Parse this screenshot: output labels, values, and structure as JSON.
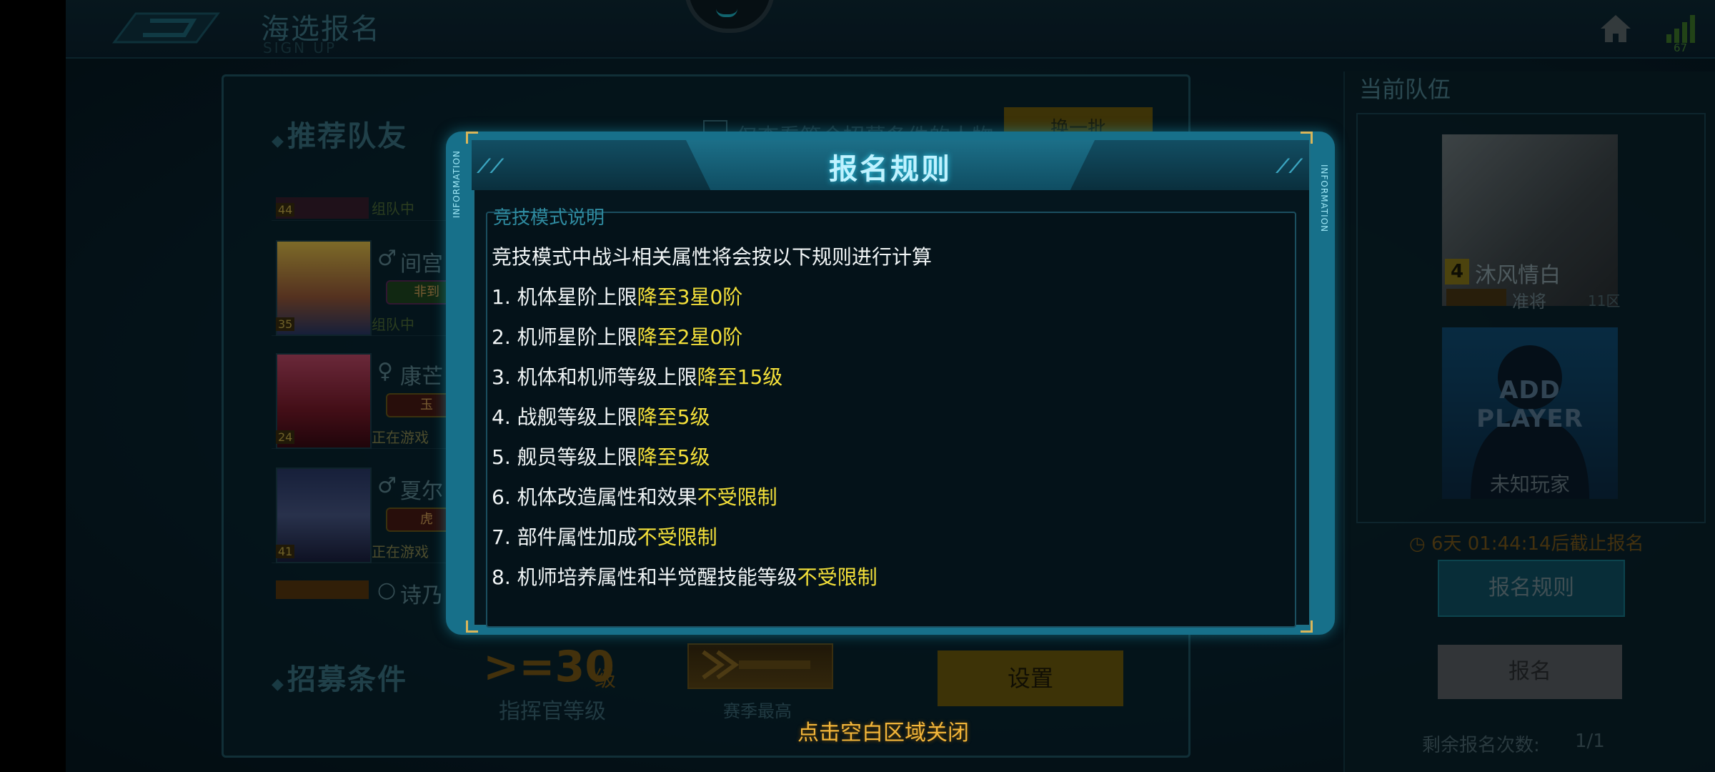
{
  "header": {
    "title": "海选报名",
    "subtitle": "SIGN UP",
    "signal_value": "67"
  },
  "recommend": {
    "title": "推荐队友",
    "filter_label": "仅查看符合招募条件的人物",
    "swap_label": "换一批",
    "mates": [
      {
        "name": "",
        "status": "组队中",
        "level": "44"
      },
      {
        "name": "间宫",
        "status": "组队中",
        "level": "35",
        "tag": "非到"
      },
      {
        "name": "康芒",
        "status": "正在游戏",
        "level": "24",
        "tag": "玉"
      },
      {
        "name": "夏尔",
        "status": "正在游戏",
        "level": "41",
        "tag": "虎"
      },
      {
        "name": "诗乃",
        "status": "",
        "level": ""
      }
    ]
  },
  "recruit": {
    "title": "招募条件",
    "level_value": ">=30",
    "level_unit": "级",
    "level_label": "指挥官等级",
    "rank_label": "赛季最高",
    "set_label": "设置"
  },
  "team": {
    "title": "当前队伍",
    "player": {
      "level": "4",
      "name": "沐风情白",
      "rank": "准将",
      "zone": "11区"
    },
    "add_player_title": "ADD PLAYER",
    "add_player_sub": "未知玩家",
    "deadline": "6天 01:44:14后截止报名",
    "rules_button": "报名规则",
    "signup_button": "报名",
    "remain_label": "剩余报名次数:",
    "remain_value": "1/1"
  },
  "modal": {
    "title": "报名规则",
    "side_label": "INFORMATION",
    "section_head": "竞技模式说明",
    "intro": "竞技模式中战斗相关属性将会按以下规则进行计算",
    "rules": [
      {
        "prefix": "1. 机体星阶上限",
        "highlight": "降至3星0阶"
      },
      {
        "prefix": "2. 机师星阶上限",
        "highlight": "降至2星0阶"
      },
      {
        "prefix": "3. 机体和机师等级上限",
        "highlight": "降至15级"
      },
      {
        "prefix": "4. 战舰等级上限",
        "highlight": "降至5级"
      },
      {
        "prefix": "5. 舰员等级上限",
        "highlight": "降至5级"
      },
      {
        "prefix": "6. 机体改造属性和效果",
        "highlight": "不受限制"
      },
      {
        "prefix": "7. 部件属性加成",
        "highlight": "不受限制"
      },
      {
        "prefix": "8. 机师培养属性和半觉醒技能等级",
        "highlight": "不受限制"
      }
    ],
    "close_hint": "点击空白区域关闭"
  },
  "colors": {
    "highlight": "#f5e13a",
    "modal_frame": "#17708a",
    "close_hint": "#f3b63a"
  }
}
